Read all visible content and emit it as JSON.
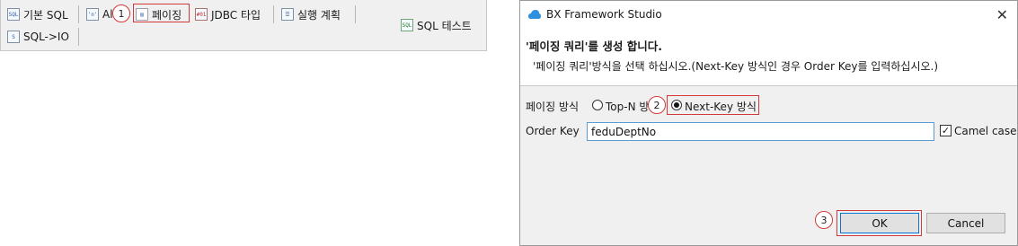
{
  "toolbar": {
    "basic_sql": {
      "label": "기본 SQL",
      "icon": "sql-icon"
    },
    "all": {
      "label": "Al",
      "icon": "quote-icon"
    },
    "paging": {
      "label": "페이징",
      "icon": "document-icon"
    },
    "jdbc_type": {
      "label": "JDBC 타입",
      "icon": "jdbc-icon"
    },
    "exec_plan": {
      "label": "실행 계획",
      "icon": "plan-icon"
    },
    "sql_test": {
      "label": "SQL 테스트",
      "icon": "sql-test-icon"
    },
    "sql_io": {
      "label": "SQL->IO",
      "icon": "sql-io-icon"
    },
    "step1": "1"
  },
  "dialog": {
    "title": "BX Framework Studio",
    "close_glyph": "✕",
    "banner_title": "'페이징 쿼리'를 생성 합니다.",
    "banner_desc": "'페이징 쿼리'방식을 선택 하십시오.(Next-Key 방식인 경우 Order Key를 입력하십시오.)",
    "paging_method_label": "페이징 방식",
    "option_topn": "Top-N 방",
    "option_nextkey": "Next-Key 방식",
    "selected_option": "Next-Key 방식",
    "order_key_label": "Order Key",
    "order_key_value": "feduDeptNo",
    "camel_case_label": "Camel case",
    "camel_case_checked": true,
    "check_glyph": "✓",
    "ok_label": "OK",
    "cancel_label": "Cancel",
    "step2": "2",
    "step3": "3"
  },
  "colors": {
    "highlight": "#d23a3a",
    "input_border": "#5a9bd5",
    "app_icon": "#2f8fe0"
  }
}
